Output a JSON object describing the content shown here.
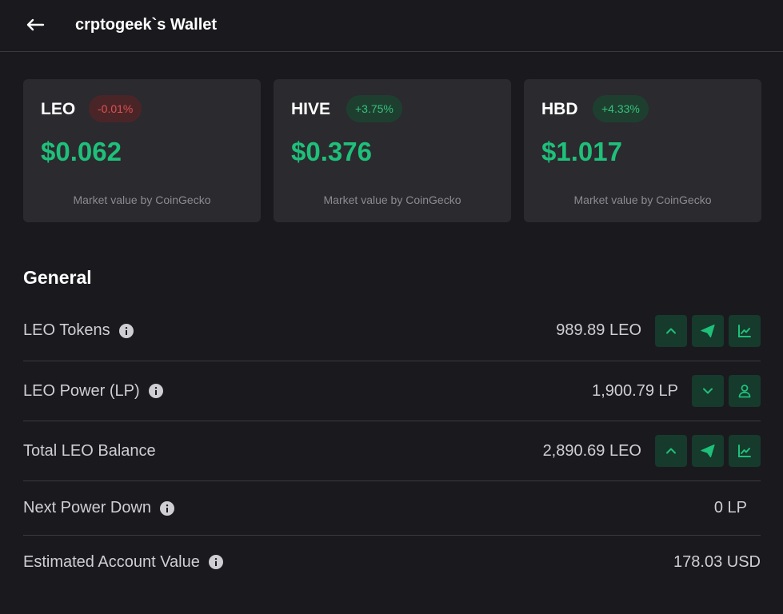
{
  "header": {
    "title": "crptogeek`s Wallet",
    "back_icon": "arrow-left-icon"
  },
  "tokens": [
    {
      "symbol": "LEO",
      "change": "-0.01%",
      "change_status": "negative",
      "price": "$0.062",
      "source": "Market value by CoinGecko"
    },
    {
      "symbol": "HIVE",
      "change": "+3.75%",
      "change_status": "positive",
      "price": "$0.376",
      "source": "Market value by CoinGecko"
    },
    {
      "symbol": "HBD",
      "change": "+4.33%",
      "change_status": "positive",
      "price": "$1.017",
      "source": "Market value by CoinGecko"
    }
  ],
  "general": {
    "title": "General",
    "rows": [
      {
        "label": "LEO Tokens",
        "info": true,
        "value": "989.89 LEO",
        "actions": [
          "chevron-up-icon",
          "send-icon",
          "chart-icon"
        ]
      },
      {
        "label": "LEO Power (LP)",
        "info": true,
        "value": "1,900.79 LP",
        "actions": [
          "chevron-down-icon",
          "user-icon"
        ]
      },
      {
        "label": "Total LEO Balance",
        "info": false,
        "value": "2,890.69 LEO",
        "actions": [
          "chevron-up-icon",
          "send-icon",
          "chart-icon"
        ]
      },
      {
        "label": "Next Power Down",
        "info": true,
        "value": "0 LP",
        "actions": []
      },
      {
        "label": "Estimated Account Value",
        "info": true,
        "value": "178.03 USD",
        "actions": []
      }
    ]
  },
  "colors": {
    "background": "#1a191e",
    "card": "#2b2a2f",
    "accent_green": "#1ec07a",
    "negative_red": "#e2504f",
    "action_button": "#163a2c"
  }
}
